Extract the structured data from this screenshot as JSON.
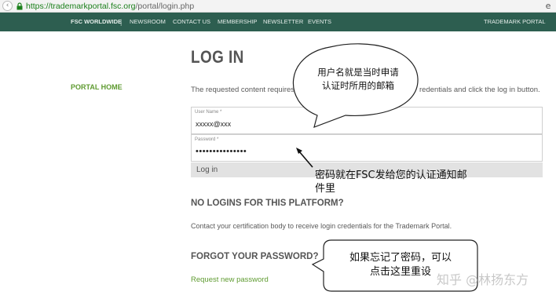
{
  "browser": {
    "url_host": "https://trademarkportal.fsc.org",
    "url_path": "/portal/login.php",
    "back_icon": "circle-back-icon",
    "lock_icon": "lock-icon",
    "menu_icon": "menu-icon",
    "menu_glyph": "e"
  },
  "nav": {
    "brand": "FSC WORLDWIDE",
    "separator": "|",
    "items": [
      "NEWSROOM",
      "CONTACT US",
      "MEMBERSHIP",
      "NEWSLETTER",
      "EVENTS"
    ],
    "right": "TRADEMARK PORTAL",
    "background": "#2d5e50"
  },
  "sidebar": {
    "link": "PORTAL HOME",
    "color": "#5f9b31"
  },
  "login": {
    "title": "LOG IN",
    "intro_start": "The requested content requires",
    "intro_end": "redentials and click the log in button.",
    "username_label": "User Name *",
    "username_value": "xxxxx@xxx",
    "password_label": "Password *",
    "password_value": "•••••••••••••••",
    "button": "Log in"
  },
  "no_logins": {
    "title": "NO LOGINS FOR THIS PLATFORM?",
    "text": "Contact your certification body to receive login credentials for the Trademark Portal."
  },
  "forgot": {
    "title": "FORGOT YOUR PASSWORD?",
    "link": "Request new password"
  },
  "annotations": {
    "bubble_top_line1": "用户名就是当时申请",
    "bubble_top_line2": "认证时所用的邮箱",
    "arrow_text_line1": "密码就在FSC发给您的认证通知邮",
    "arrow_text_line2": "件里",
    "bubble_bottom_line1": "如果忘记了密码，可以",
    "bubble_bottom_line2": "点击这里重设"
  },
  "watermark": "知乎 @林扬东方"
}
